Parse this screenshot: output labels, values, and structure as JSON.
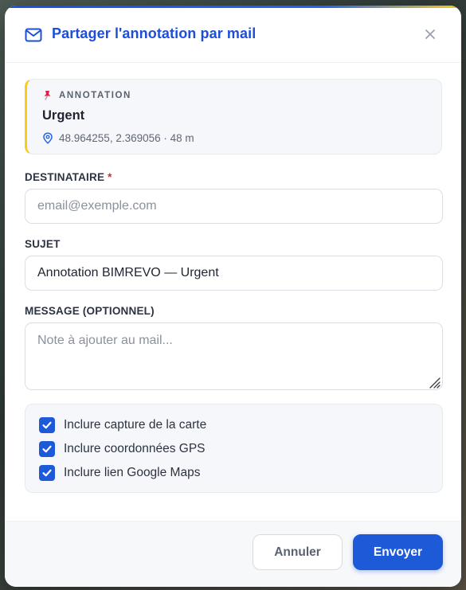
{
  "dialog": {
    "title": "Partager l'annotation par mail",
    "accent_color": "#1d4ed8",
    "highlight_color": "#facc15"
  },
  "annotation": {
    "tag": "ANNOTATION",
    "name": "Urgent",
    "coordinates": "48.964255, 2.369056 · 48 m"
  },
  "form": {
    "recipient": {
      "label": "DESTINATAIRE",
      "required_marker": "*",
      "placeholder": "email@exemple.com",
      "value": ""
    },
    "subject": {
      "label": "SUJET",
      "value": "Annotation BIMREVO — Urgent"
    },
    "message": {
      "label": "MESSAGE (OPTIONNEL)",
      "placeholder": "Note à ajouter au mail...",
      "value": ""
    },
    "options": [
      {
        "label": "Inclure capture de la carte",
        "checked": true
      },
      {
        "label": "Inclure coordonnées GPS",
        "checked": true
      },
      {
        "label": "Inclure lien Google Maps",
        "checked": true
      }
    ]
  },
  "footer": {
    "cancel_label": "Annuler",
    "send_label": "Envoyer"
  }
}
